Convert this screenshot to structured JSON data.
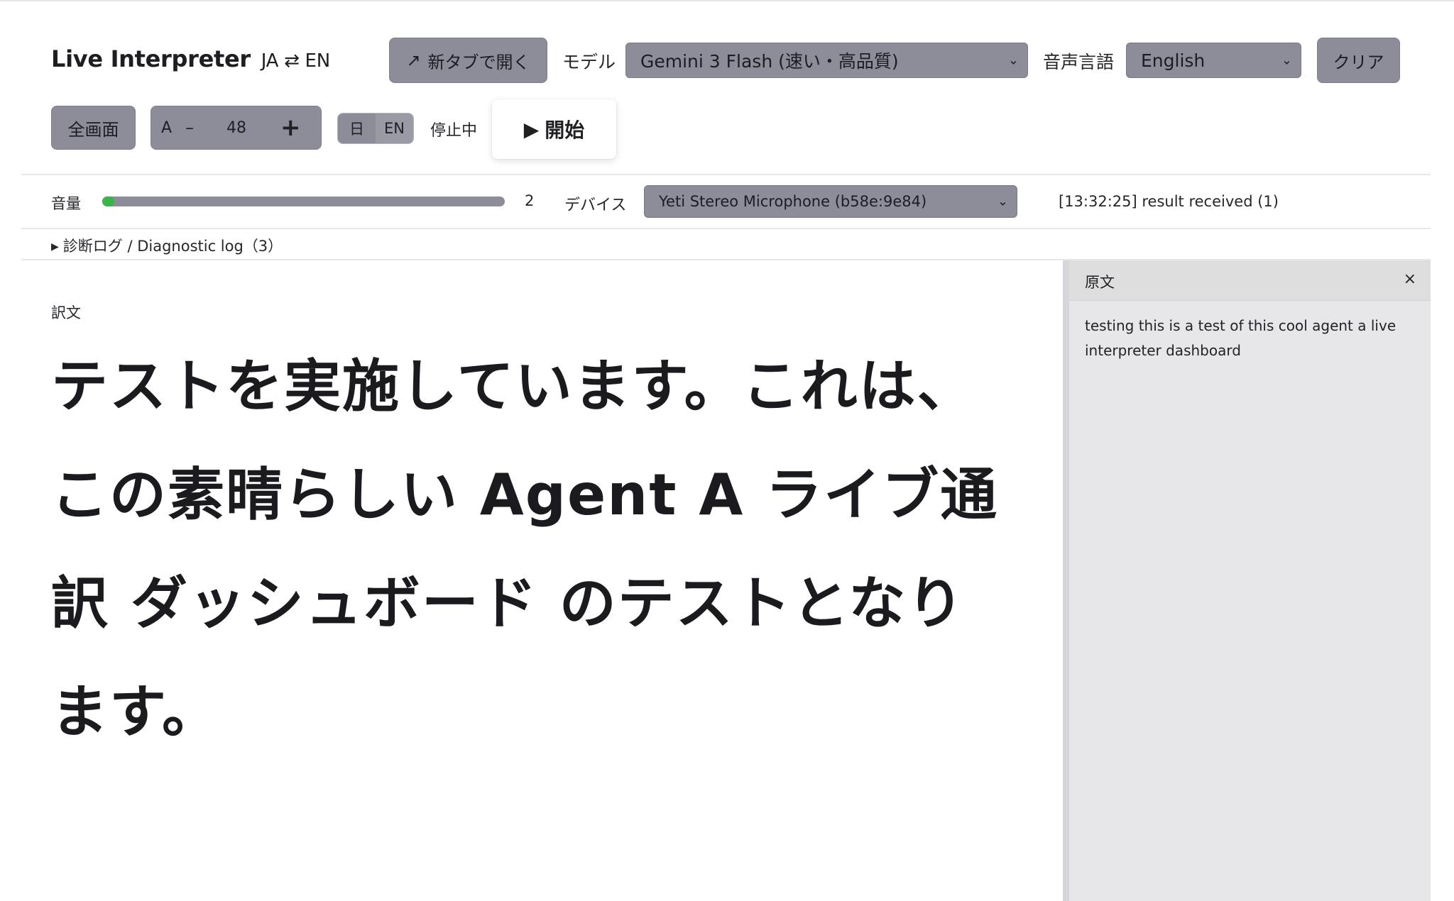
{
  "header": {
    "title": "Live Interpreter",
    "subtitle": "JA ⇄ EN",
    "open_tab_icon": "↗",
    "open_tab_label": "新タブで開く",
    "model_label": "モデル",
    "model_value": "Gemini 3 Flash (速い・高品質)",
    "voice_lang_label": "音声言語",
    "voice_lang_value": "English",
    "clear_label": "クリア"
  },
  "controls": {
    "fullscreen_label": "全画面",
    "font_a": "A",
    "font_minus": "–",
    "font_size": "48",
    "font_plus": "+",
    "dir_ja": "日",
    "dir_en": "EN",
    "status": "停止中",
    "start_icon": "▶",
    "start_label": "開始"
  },
  "audio": {
    "level_label": "音量",
    "level_fraction": 0.03,
    "level_value": "2",
    "device_label": "デバイス",
    "device_value": "Yeti Stereo Microphone (b58e:9e84)",
    "log_line": "[13:32:25] result received (1)"
  },
  "diagnostic": {
    "toggle_icon": "▶",
    "label": "診断ログ / Diagnostic log（3）"
  },
  "translation": {
    "label": "訳文",
    "lines": [
      "テストを実施しています。これは、",
      "この素晴らしい Agent A ライブ通",
      "訳 ダッシュボード のテストとなり",
      "ます。"
    ]
  },
  "source_panel": {
    "title": "原文",
    "close": "×",
    "text": "testing this is a test of this cool agent a live interpreter dashboard"
  },
  "colors": {
    "control_gray": "#8d8d99",
    "meter_green": "#39b54a",
    "panel_bg": "#e7e7ea"
  }
}
